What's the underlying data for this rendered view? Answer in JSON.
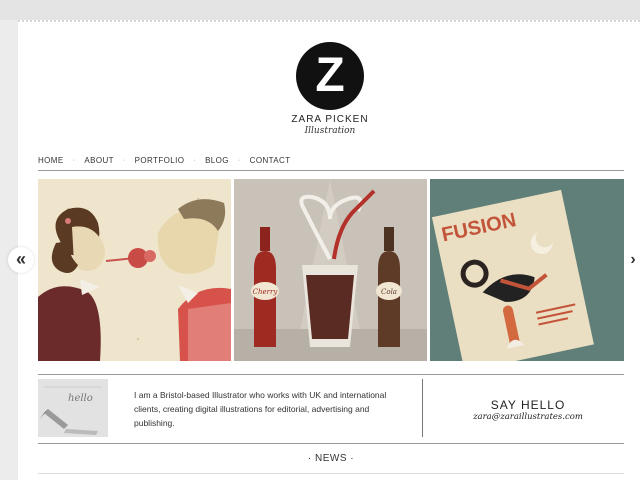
{
  "logo": {
    "letter": "Z",
    "name": "ZARA PICKEN",
    "tagline": "Illustration"
  },
  "nav": {
    "items": [
      "HOME",
      "ABOUT",
      "PORTFOLIO",
      "BLOG",
      "CONTACT"
    ],
    "separator": "·"
  },
  "gallery": {
    "prev_arrow": "«",
    "next_arrow": "›",
    "panels": [
      {
        "subject": "couple-illustration"
      },
      {
        "subject": "drink-bottles-illustration",
        "bottle_left_label": "Cherry",
        "bottle_right_label": "Cola"
      },
      {
        "subject": "magazine-cover-illustration",
        "magazine_title": "FUSION"
      }
    ]
  },
  "intro": {
    "thumb_text": "hello",
    "text": "I am a Bristol-based Illustrator who works with UK and international clients, creating digital illustrations for editorial, advertising and publishing.",
    "say_hello": "SAY HELLO",
    "email": "zara@zaraillustrates.com"
  },
  "news": {
    "heading": "· NEWS ·"
  },
  "colors": {
    "page_bg": "#ececec",
    "content_bg": "#ffffff",
    "logo_bg": "#111111",
    "panel1_bg": "#efe4cc",
    "panel2_bg": "#c9c2b8",
    "panel3_bg": "#5f7f78",
    "accent_red": "#b33a2c"
  }
}
